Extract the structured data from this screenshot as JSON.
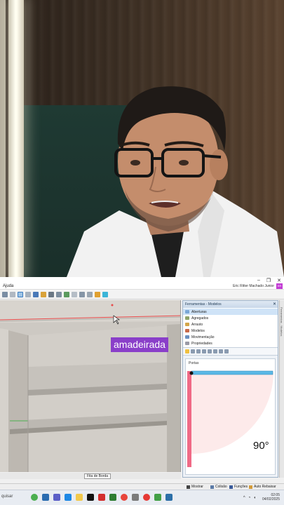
{
  "window": {
    "menu_help": "Ajuda",
    "user_name": "Eric Ritter Machado Junior",
    "user_badge": "ER",
    "controls": [
      "–",
      "❐",
      "✕"
    ]
  },
  "caption": "amadeirada",
  "panel": {
    "title": "Ferramentas - Modelos",
    "items": [
      {
        "label": "Aberturas",
        "icon": "door-icon",
        "active": true
      },
      {
        "label": "Agregados",
        "icon": "box-icon",
        "active": false
      },
      {
        "label": "Arrasto",
        "icon": "drag-icon",
        "active": false
      },
      {
        "label": "Modelos",
        "icon": "model-icon",
        "active": false
      },
      {
        "label": "Movimentação",
        "icon": "move-icon",
        "active": false
      },
      {
        "label": "Propriedades",
        "icon": "properties-icon",
        "active": false
      }
    ],
    "preview_label": "Portas",
    "angle": "90°"
  },
  "side_strip_label": "Ferramentas - Modelos",
  "status": {
    "edge_button": "Fita de Borda"
  },
  "bottom_bar": {
    "show": "Mostrar",
    "collision": "Colisão",
    "functions": "Funções",
    "auto_lower": "Auto Rebaixar"
  },
  "taskbar": {
    "search_text": "quisar",
    "time": "02:05",
    "date": "04/02/2025"
  },
  "colors": {
    "caption_bg": "#8a3fc9",
    "door_blue": "#5bb8e6",
    "door_pink": "#f06a86",
    "active_item": "#cfe3f7"
  }
}
